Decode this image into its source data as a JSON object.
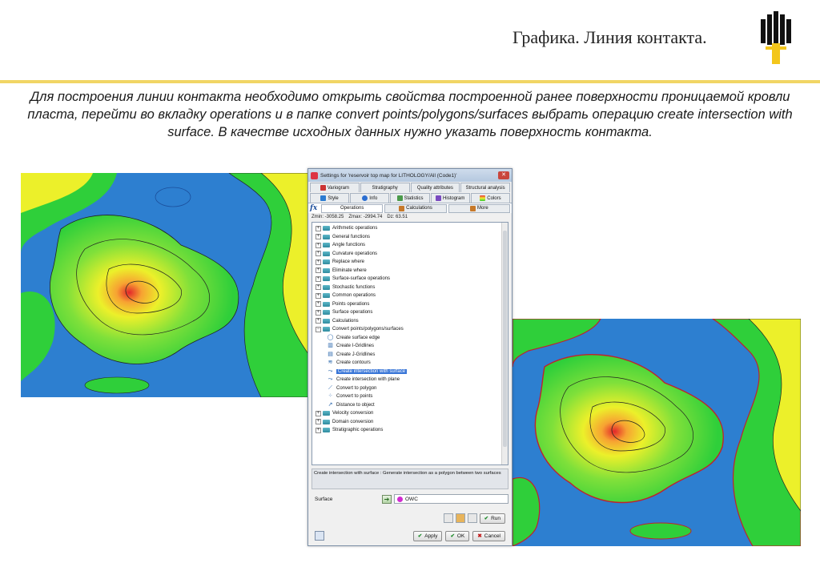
{
  "slide": {
    "title": "Графика. Линия контакта.",
    "body": "Для построения линии контакта необходимо открыть свойства построенной ранее поверхности проницаемой кровли пласта, перейти во вкладку operations и в папке convert points/polygons/surfaces выбрать операцию create intersection with surface. В качестве исходных данных нужно указать поверхность контакта."
  },
  "colors": {
    "accent_rule": "#f1d565",
    "logo_black": "#111111",
    "logo_yellow": "#f3c61b",
    "map_blue": "#2d7fd0",
    "map_green": "#2fcf3a",
    "map_yellow": "#ecf02a",
    "map_orange": "#f7a232",
    "map_red": "#e3262a",
    "selection": "#3875d7"
  },
  "dialog": {
    "title": "Settings for 'reservoir top map for LITHOLOGY/All (Code1)'",
    "close_label": "✕",
    "tabs_row1": [
      "Variogram",
      "Stratigraphy",
      "Quality attributes",
      "Structural analysis"
    ],
    "tabs_row2": [
      "Style",
      "Info",
      "Statistics",
      "Histogram",
      "Colors"
    ],
    "fx_label": "fx",
    "op_tabs": [
      "Operations",
      "Calculations",
      "More"
    ],
    "zinfo": {
      "zmin": "Zmin: -3058.25",
      "zmax": "Zmax: -2994.74",
      "dz": "Dz: 63.51"
    },
    "tree": {
      "folders_top": [
        "Arithmetic operations",
        "General functions",
        "Angle functions",
        "Curvature operations",
        "Replace where",
        "Eliminate where",
        "Surface-surface operations",
        "Stochastic functions",
        "Common operations",
        "Points operations",
        "Surface operations",
        "Calculations"
      ],
      "open_folder": "Convert points/polygons/surfaces",
      "children": [
        "Create surface edge",
        "Create I-Gridlines",
        "Create J-Gridlines",
        "Create contours",
        "Create intersection with surface",
        "Create intersection with plane",
        "Convert to polygon",
        "Convert to points",
        "Distance to object"
      ],
      "selected": "Create intersection with surface",
      "folders_bottom": [
        "Velocity conversion",
        "Domain conversion",
        "Stratigraphic operations"
      ]
    },
    "description": "Create intersection with surface : Generate intersection as a polygon between two surfaces",
    "surface_label": "Surface",
    "surface_value": "OWC",
    "buttons": {
      "run": "Run",
      "apply": "Apply",
      "ok": "OK",
      "cancel": "Cancel"
    }
  }
}
